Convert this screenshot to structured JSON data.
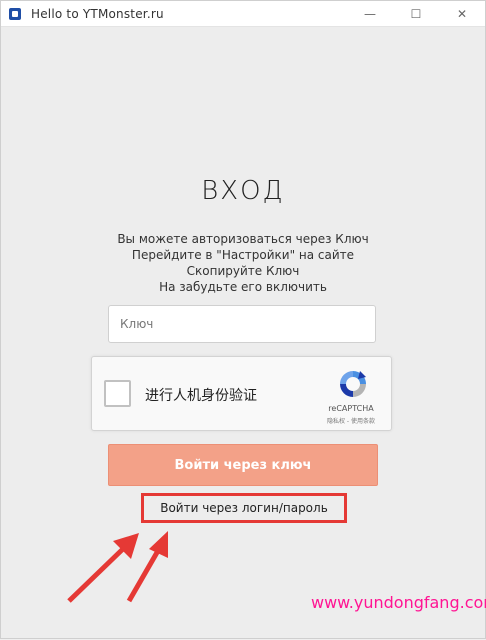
{
  "window": {
    "title": "Hello to YTMonster.ru",
    "controls": {
      "minimize": "—",
      "maximize": "☐",
      "close": "✕"
    }
  },
  "login": {
    "heading": "ВХОД",
    "instructions": [
      "Вы можете авторизоваться через Ключ",
      "Перейдите в \"Настройки\" на сайте",
      "Скопируйте Ключ",
      "На забудьте его включить"
    ],
    "key_placeholder": "Ключ",
    "captcha": {
      "label": "进行人机身份验证",
      "brand": "reCAPTCHA",
      "terms": "隐私权 - 使用条款"
    },
    "login_with_key_label": "Войти через ключ",
    "login_with_password_label": "Войти через логин/пароль"
  },
  "watermark": "www.yundongfang.com",
  "colors": {
    "primary_button": "#f3a188",
    "highlight_box": "#e53935",
    "watermark": "#ff1493"
  }
}
